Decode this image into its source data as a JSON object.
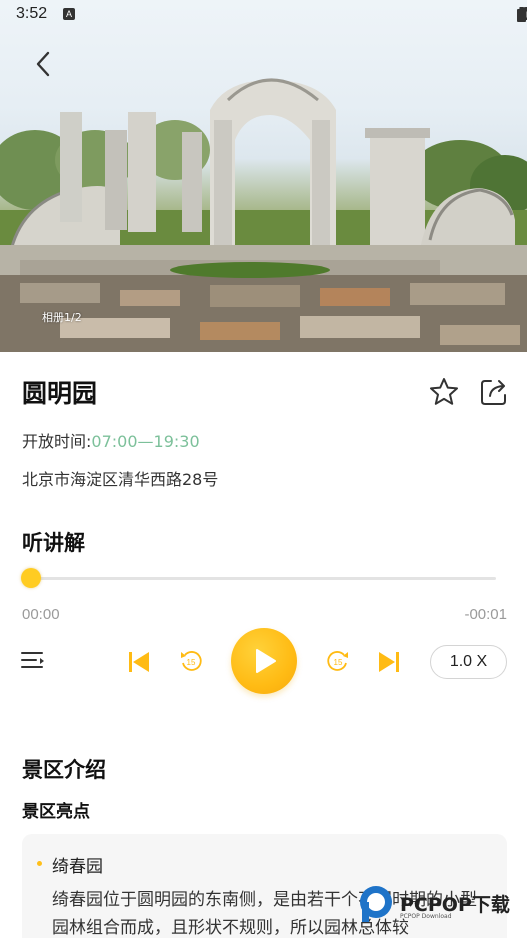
{
  "status_bar": {
    "time": "3:52",
    "notification_icon": "A"
  },
  "hero": {
    "album_label": "相册1/2",
    "image_subject": "old-summer-palace-ruins"
  },
  "attraction": {
    "name": "圆明园",
    "hours_label": "开放时间:",
    "hours_value": "07:00—19:30",
    "address": "北京市海淀区清华西路28号"
  },
  "audio": {
    "heading": "听讲解",
    "progress": 0,
    "time_elapsed": "00:00",
    "time_remaining": "-00:01",
    "speed": "1.0 X",
    "accent_color": "#ffbb14"
  },
  "intro": {
    "heading": "景区介绍",
    "highlight_heading": "景区亮点",
    "items": [
      {
        "title": "绮春园",
        "description": "绮春园位于圆明园的东南侧，是由若干个不同时期的小型园林组合而成，且形状不规则，所以园林总体较"
      }
    ]
  },
  "watermark": {
    "text": "PCPOP下载",
    "subtext": "PCPOP Download"
  },
  "colors": {
    "hours_value": "#7cc09a",
    "accent": "#ffbb14"
  }
}
